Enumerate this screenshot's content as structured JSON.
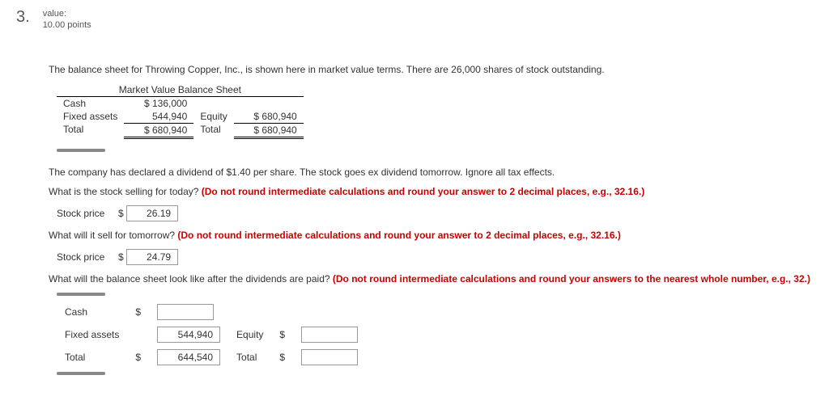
{
  "question": {
    "number": "3.",
    "value_label": "value:",
    "points": "10.00 points"
  },
  "intro": "The balance sheet for Throwing Copper, Inc., is shown here in market value terms. There are 26,000 shares of stock outstanding.",
  "bs1": {
    "title": "Market Value Balance Sheet",
    "rows": {
      "cash_label": "Cash",
      "cash_val": "$ 136,000",
      "fixed_label": "Fixed assets",
      "fixed_val": "544,940",
      "equity_label": "Equity",
      "equity_val": "$ 680,940",
      "total_label": "Total",
      "total_left": "$ 680,940",
      "total_label2": "Total",
      "total_right": "$ 680,940"
    }
  },
  "para2": "The company has declared a dividend of $1.40 per share. The stock goes ex dividend tomorrow. Ignore all tax effects.",
  "q1_a": "What is the stock selling for today? ",
  "q1_b": "(Do not round intermediate calculations and round your answer to 2 decimal places, e.g., 32.16.)",
  "a1": {
    "label": "Stock price",
    "currency": "$",
    "value": "26.19"
  },
  "q2_a": "What will it sell for tomorrow? ",
  "q2_b": "(Do not round intermediate calculations and round your answer to 2 decimal places, e.g., 32.16.)",
  "a2": {
    "label": "Stock price",
    "currency": "$",
    "value": "24.79"
  },
  "q3_a": "What will the balance sheet look like after the dividends are paid? ",
  "q3_b": "(Do not round intermediate calculations and round your answers to the nearest whole number, e.g., 32.)",
  "bs2": {
    "cash_label": "Cash",
    "cash_cur": "$",
    "fixed_label": "Fixed assets",
    "fixed_val": "544,940",
    "equity_label": "Equity",
    "equity_cur": "$",
    "total_label": "Total",
    "total_cur": "$",
    "total_left": "644,540",
    "total_label2": "Total",
    "total_cur2": "$"
  }
}
